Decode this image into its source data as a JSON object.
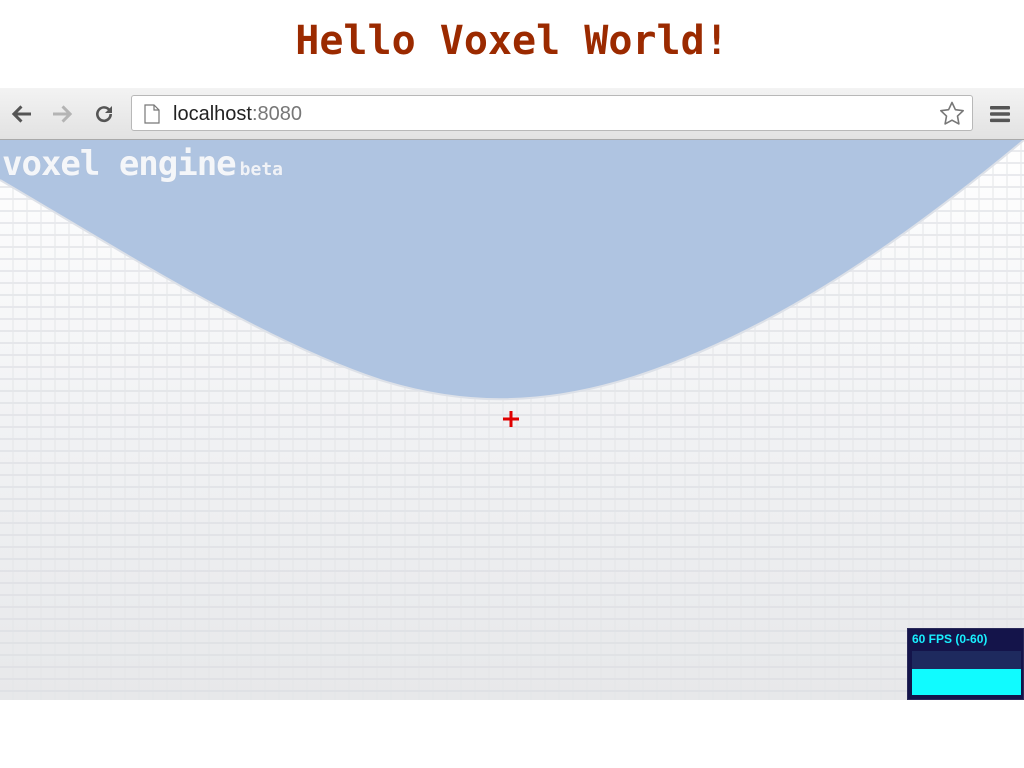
{
  "slide": {
    "title": "Hello Voxel World!"
  },
  "browser": {
    "url_host": "localhost",
    "url_port": ":8080",
    "icons": {
      "back": "arrow-left-icon",
      "forward": "arrow-right-icon",
      "reload": "reload-icon",
      "page": "page-icon",
      "bookmark": "star-icon",
      "menu": "hamburger-menu-icon"
    }
  },
  "game": {
    "logo_text": "voxel engine",
    "logo_badge": "beta",
    "crosshair_color": "#e00000",
    "sky_color": "#afc4e1",
    "terrain_color": "#f2f3f5"
  },
  "fps_meter": {
    "label": "60 FPS (0-60)",
    "fill_fraction": 0.6,
    "fill_color": "#10fbff",
    "bg_color": "#14144a"
  }
}
